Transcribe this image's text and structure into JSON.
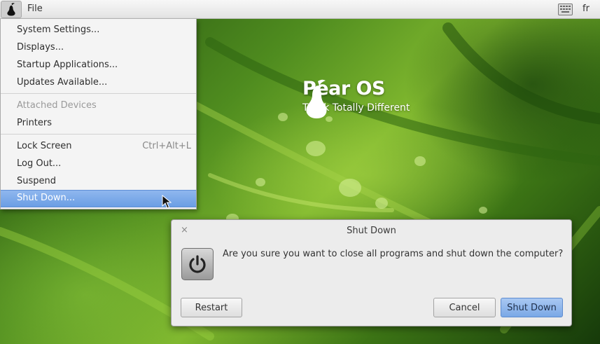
{
  "top_panel": {
    "file_menu_label": "File",
    "language_indicator": "fr",
    "pear_menu_icon": "pear-logo-icon",
    "keyboard_icon": "keyboard-icon"
  },
  "wallpaper": {
    "brand_title": "Pear OS",
    "brand_tagline": "Think Totally Different"
  },
  "system_menu": {
    "items": [
      {
        "label": "System Settings..."
      },
      {
        "label": "Displays..."
      },
      {
        "label": "Startup Applications..."
      },
      {
        "label": "Updates Available..."
      },
      {
        "label": "Attached Devices",
        "disabled": true
      },
      {
        "label": "Printers"
      },
      {
        "label": "Lock Screen",
        "accelerator": "Ctrl+Alt+L"
      },
      {
        "label": "Log Out..."
      },
      {
        "label": "Suspend"
      },
      {
        "label": "Shut Down...",
        "selected": true
      }
    ]
  },
  "dialog": {
    "title": "Shut Down",
    "close_glyph": "×",
    "icon": "power-icon",
    "message": "Are you sure you want to close all programs and shut down the computer?",
    "restart_label": "Restart",
    "cancel_label": "Cancel",
    "shutdown_label": "Shut Down"
  },
  "colors": {
    "selection": "#7aa8e6",
    "panel": "#ececec",
    "wallpaper_green": "#4f8c1f"
  }
}
